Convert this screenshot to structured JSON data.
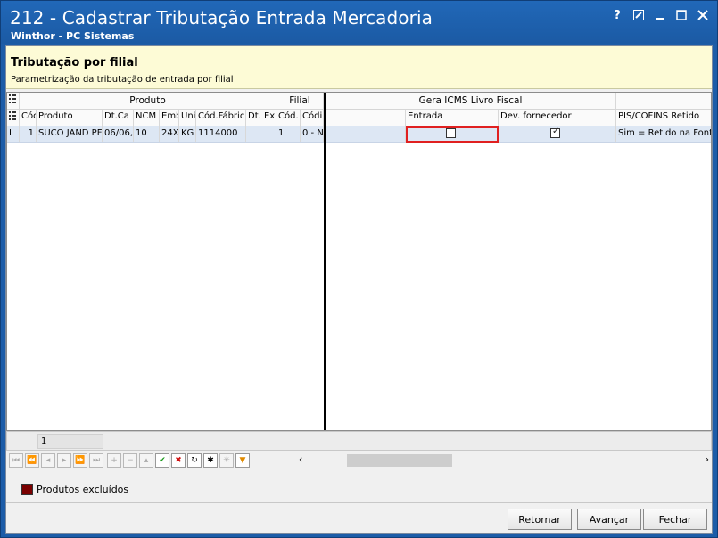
{
  "window": {
    "title": "212 - Cadastrar Tributação Entrada Mercadoria",
    "subtitle": "Winthor - PC Sistemas"
  },
  "header": {
    "title": "Tributação por filial",
    "description": "Parametrização da tributação de entrada por filial"
  },
  "grid": {
    "group_headers": [
      "Produto",
      "Filial",
      "Gera ICMS Livro Fiscal"
    ],
    "columns": [
      "Cód",
      "Produto",
      "Dt.Ca",
      "NCM",
      "Emb",
      "Uni",
      "Cód.Fábric",
      "Dt. Ex",
      "Cód.",
      "Códi",
      "Entrada",
      "Dev. fornecedor",
      "PIS/COFINS Retido"
    ],
    "rows": [
      {
        "indicator": "I",
        "values": [
          "1",
          "SUCO JAND PF",
          "06/06,",
          "10",
          "24X",
          "KG",
          "1114000",
          "",
          "1",
          "0 - N"
        ],
        "entrada_checked": false,
        "dev_fornecedor_checked": true,
        "pis_cofins": "Sim = Retido na Font"
      }
    ]
  },
  "footer": {
    "record_value": "1"
  },
  "legend": {
    "label": "Produtos excluídos",
    "color": "#7a0000"
  },
  "buttons": {
    "back": "Retornar",
    "next": "Avançar",
    "close": "Fechar"
  }
}
